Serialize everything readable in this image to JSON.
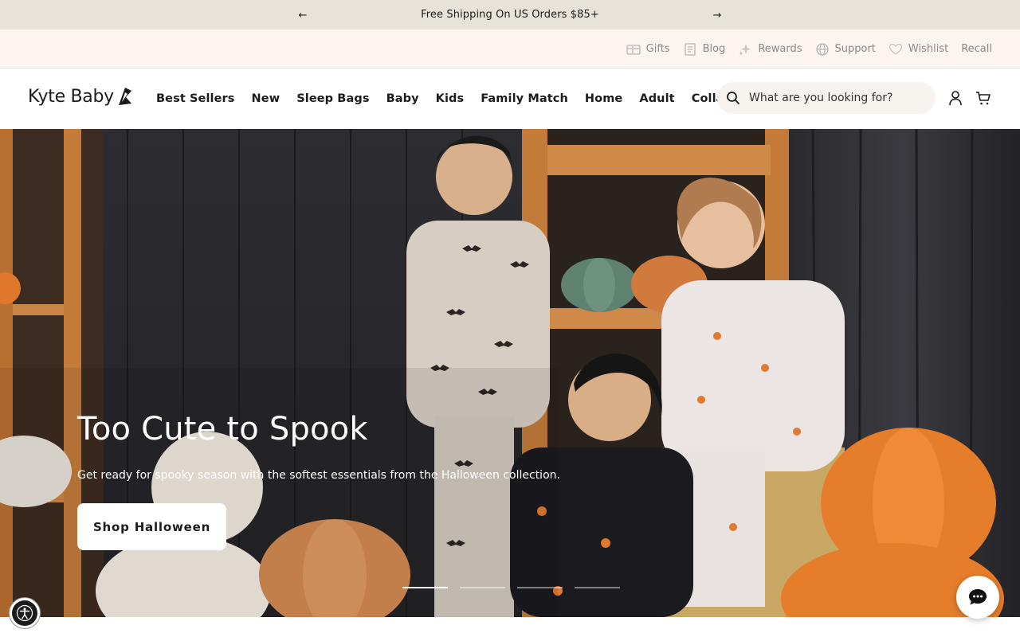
{
  "announcement": {
    "text": "Free Shipping On US Orders $85+",
    "prev_icon": "arrow-left-icon",
    "next_icon": "arrow-right-icon"
  },
  "utility": {
    "links": [
      {
        "label": "Gifts",
        "icon": "gift-card-icon"
      },
      {
        "label": "Blog",
        "icon": "blog-icon"
      },
      {
        "label": "Rewards",
        "icon": "sparkle-icon"
      },
      {
        "label": "Support",
        "icon": "globe-icon"
      },
      {
        "label": "Wishlist",
        "icon": "heart-icon"
      },
      {
        "label": "Recall",
        "icon": ""
      }
    ]
  },
  "header": {
    "logo_text": "Kyte Baby",
    "nav": [
      "Best Sellers",
      "New",
      "Sleep Bags",
      "Baby",
      "Kids",
      "Family Match",
      "Home",
      "Adult",
      "Collabs"
    ],
    "search_placeholder": "What are you looking for?"
  },
  "hero": {
    "title": "Too Cute to Spook",
    "subtitle": "Get ready for spooky season with the softest essentials from the Halloween collection.",
    "cta": "Shop Halloween",
    "slides_total": 4,
    "active_slide": 1
  },
  "colors": {
    "announcement_bg": "#e8e3d8",
    "utility_bg": "#fcf4ef",
    "search_bg": "#f7f3ef",
    "pumpkin": "#e07a2e",
    "wood": "#c57a3c"
  }
}
